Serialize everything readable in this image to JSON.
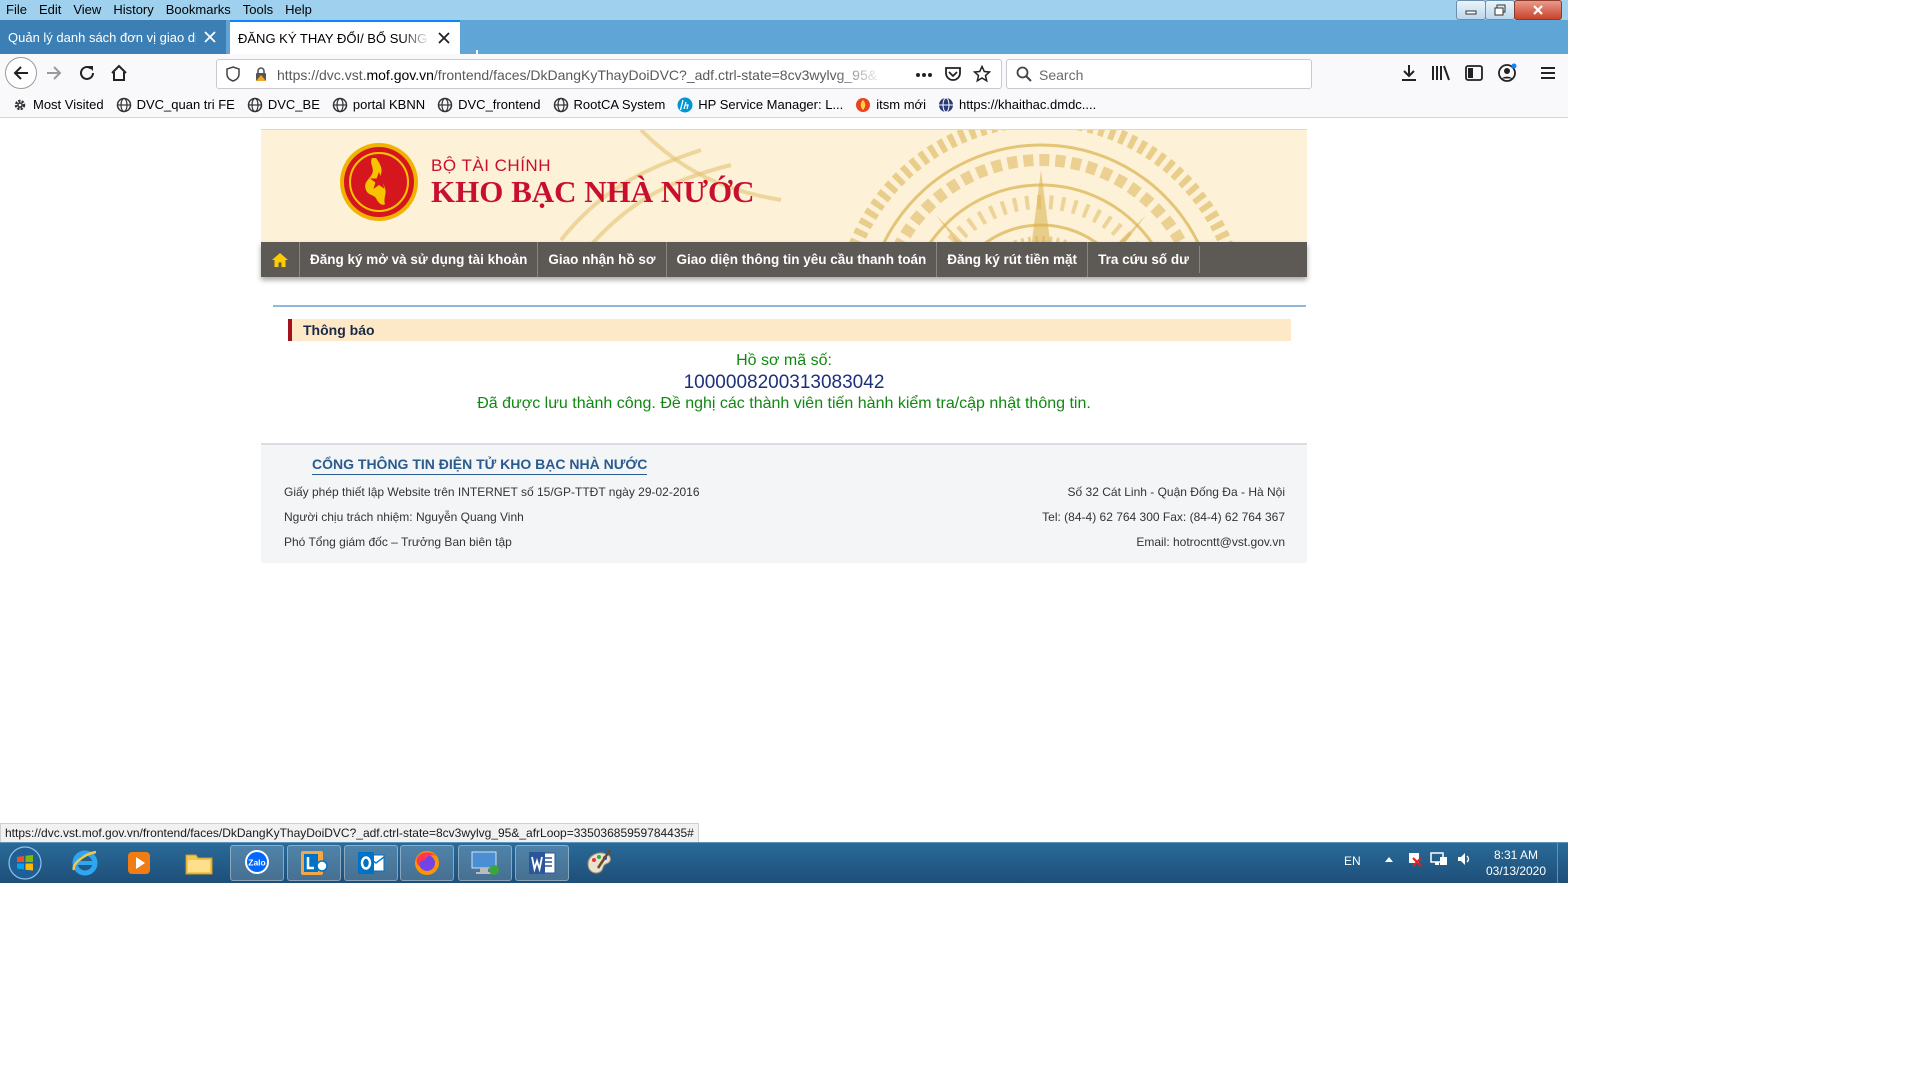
{
  "menu": [
    "File",
    "Edit",
    "View",
    "History",
    "Bookmarks",
    "Tools",
    "Help"
  ],
  "tabs": [
    {
      "title": "Quản lý danh sách đơn vị giao dịch"
    },
    {
      "title": "ĐĂNG KÝ THAY ĐỔI/ BỔ SUNG DỊCH VỤ CÔNG"
    }
  ],
  "address": {
    "prefix": "https://dvc.vst.",
    "domain": "mof.gov.vn",
    "path": "/frontend/faces/DkDangKyThayDoiDVC?_adf.ctrl-state=8cv3wylvg_95&"
  },
  "search": {
    "placeholder": "Search"
  },
  "bookmarks": [
    {
      "label": "Most Visited",
      "icon": "gear-icon"
    },
    {
      "label": "DVC_quan tri FE",
      "icon": "globe-icon"
    },
    {
      "label": "DVC_BE",
      "icon": "globe-icon"
    },
    {
      "label": "portal KBNN",
      "icon": "globe-icon"
    },
    {
      "label": "DVC_frontend",
      "icon": "globe-icon"
    },
    {
      "label": "RootCA System",
      "icon": "globe-icon"
    },
    {
      "label": "HP Service Manager: L...",
      "icon": "hp-icon"
    },
    {
      "label": "itsm mới",
      "icon": "itsm-icon"
    },
    {
      "label": "https://khaithac.dmdc....",
      "icon": "globe-icon"
    }
  ],
  "banner": {
    "ministry": "BỘ TÀI CHÍNH",
    "name": "KHO BẠC NHÀ NƯỚC"
  },
  "nav": [
    "Đăng ký mở và sử dụng tài khoản",
    "Giao nhận hồ sơ",
    "Giao diện thông tin yêu cầu thanh toán",
    "Đăng ký rút tiền mặt",
    "Tra cứu số dư"
  ],
  "notice": {
    "title": "Thông báo",
    "label": "Hồ sơ mã số:",
    "code": "1000008200313083042",
    "message": "Đã được lưu thành công. Đề nghị các thành viên tiến hành kiểm tra/cập nhật thông tin."
  },
  "footer": {
    "title": "CỔNG THÔNG TIN ĐIỆN TỬ KHO BẠC NHÀ NƯỚC",
    "left": [
      "Giấy phép thiết lập Website trên INTERNET số 15/GP-TTĐT ngày 29-02-2016",
      "Người chịu trách nhiệm: Nguyễn Quang Vinh",
      "Phó Tổng giám đốc – Trưởng Ban biên tập"
    ],
    "right": [
      "Số 32 Cát Linh - Quận Đống Đa - Hà Nội",
      "Tel: (84-4) 62 764 300 Fax: (84-4) 62 764 367",
      "Email: hotrocntt@vst.gov.vn"
    ]
  },
  "status_url": "https://dvc.vst.mof.gov.vn/frontend/faces/DkDangKyThayDoiDVC?_adf.ctrl-state=8cv3wylvg_95&_afrLoop=33503685959784435#",
  "taskbar": {
    "apps": [
      "ie-icon",
      "media-player-icon",
      "file-explorer-icon",
      "zalo-icon",
      "lync-icon",
      "outlook-icon",
      "firefox-icon",
      "remote-desktop-icon",
      "word-icon",
      "paint-icon"
    ],
    "zalo_label": "Zalo",
    "lang": "EN",
    "time": "8:31 AM",
    "date": "03/13/2020"
  },
  "colors": {
    "accent_red": "#c8102e",
    "nav_bg": "#5d5955",
    "success_green": "#118811",
    "code_blue": "#1d2f7d"
  }
}
